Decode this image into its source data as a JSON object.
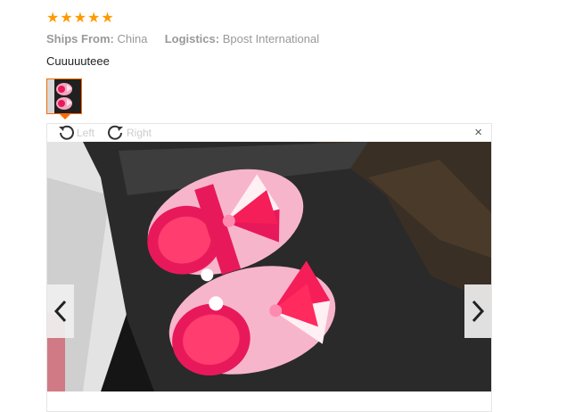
{
  "review": {
    "rating": 5,
    "stars": [
      "★",
      "★",
      "★",
      "★",
      "★"
    ],
    "ships_from_label": "Ships From:",
    "ships_from_value": "China",
    "logistics_label": "Logistics:",
    "logistics_value": "Bpost International",
    "text": "Cuuuuuteee"
  },
  "viewer": {
    "rotate_left_label": "Left",
    "rotate_right_label": "Right",
    "close_symbol": "×"
  },
  "colors": {
    "star": "#ff9900",
    "thumb_active": "#ff6a00"
  }
}
